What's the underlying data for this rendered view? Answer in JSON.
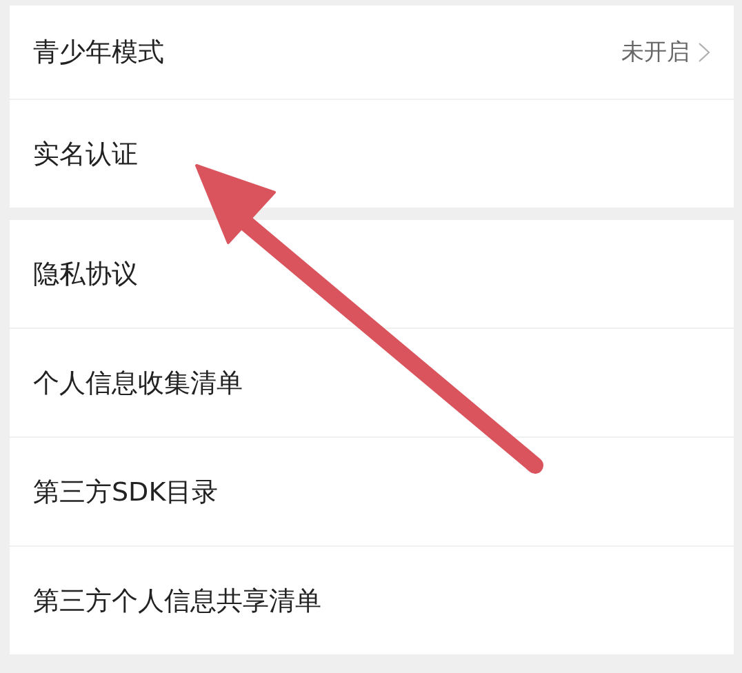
{
  "groups": [
    {
      "items": [
        {
          "label": "青少年模式",
          "value": "未开启",
          "chevron": true
        },
        {
          "label": "实名认证"
        }
      ]
    },
    {
      "items": [
        {
          "label": "隐私协议"
        },
        {
          "label": "个人信息收集清单"
        },
        {
          "label": "第三方SDK目录"
        },
        {
          "label": "第三方个人信息共享清单"
        }
      ]
    }
  ]
}
